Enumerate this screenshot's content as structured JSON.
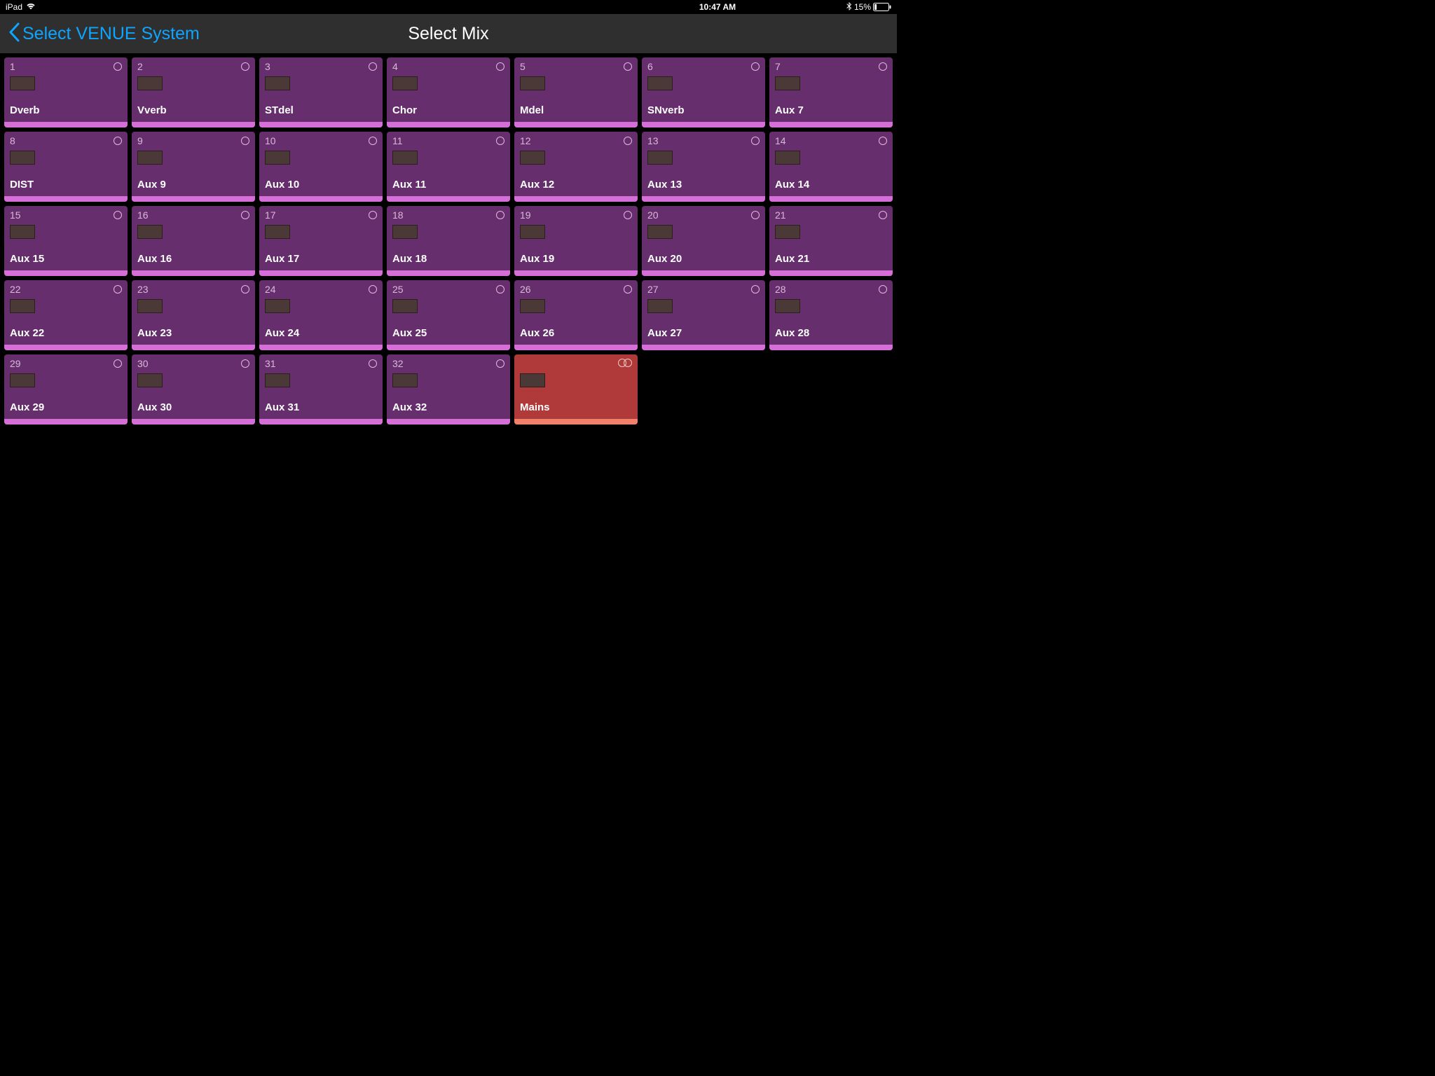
{
  "status_bar": {
    "device": "iPad",
    "time": "10:47 AM",
    "battery_pct": "15%"
  },
  "nav": {
    "back_label": "Select VENUE System",
    "title": "Select Mix"
  },
  "tiles": [
    {
      "num": "1",
      "label": "Dverb",
      "variant": "aux",
      "stereo": false
    },
    {
      "num": "2",
      "label": "Vverb",
      "variant": "aux",
      "stereo": false
    },
    {
      "num": "3",
      "label": "STdel",
      "variant": "aux",
      "stereo": false
    },
    {
      "num": "4",
      "label": "Chor",
      "variant": "aux",
      "stereo": false
    },
    {
      "num": "5",
      "label": "Mdel",
      "variant": "aux",
      "stereo": false
    },
    {
      "num": "6",
      "label": "SNverb",
      "variant": "aux",
      "stereo": false
    },
    {
      "num": "7",
      "label": "Aux 7",
      "variant": "aux",
      "stereo": false
    },
    {
      "num": "8",
      "label": "DIST",
      "variant": "aux",
      "stereo": false
    },
    {
      "num": "9",
      "label": "Aux 9",
      "variant": "aux",
      "stereo": false
    },
    {
      "num": "10",
      "label": "Aux 10",
      "variant": "aux",
      "stereo": false
    },
    {
      "num": "11",
      "label": "Aux 11",
      "variant": "aux",
      "stereo": false
    },
    {
      "num": "12",
      "label": "Aux 12",
      "variant": "aux",
      "stereo": false
    },
    {
      "num": "13",
      "label": "Aux 13",
      "variant": "aux",
      "stereo": false
    },
    {
      "num": "14",
      "label": "Aux 14",
      "variant": "aux",
      "stereo": false
    },
    {
      "num": "15",
      "label": "Aux 15",
      "variant": "aux",
      "stereo": false
    },
    {
      "num": "16",
      "label": "Aux 16",
      "variant": "aux",
      "stereo": false
    },
    {
      "num": "17",
      "label": "Aux 17",
      "variant": "aux",
      "stereo": false
    },
    {
      "num": "18",
      "label": "Aux 18",
      "variant": "aux",
      "stereo": false
    },
    {
      "num": "19",
      "label": "Aux 19",
      "variant": "aux",
      "stereo": false
    },
    {
      "num": "20",
      "label": "Aux 20",
      "variant": "aux",
      "stereo": false
    },
    {
      "num": "21",
      "label": "Aux 21",
      "variant": "aux",
      "stereo": false
    },
    {
      "num": "22",
      "label": "Aux 22",
      "variant": "aux",
      "stereo": false
    },
    {
      "num": "23",
      "label": "Aux 23",
      "variant": "aux",
      "stereo": false
    },
    {
      "num": "24",
      "label": "Aux 24",
      "variant": "aux",
      "stereo": false
    },
    {
      "num": "25",
      "label": "Aux 25",
      "variant": "aux",
      "stereo": false
    },
    {
      "num": "26",
      "label": "Aux 26",
      "variant": "aux",
      "stereo": false
    },
    {
      "num": "27",
      "label": "Aux 27",
      "variant": "aux",
      "stereo": false
    },
    {
      "num": "28",
      "label": "Aux 28",
      "variant": "aux",
      "stereo": false
    },
    {
      "num": "29",
      "label": "Aux 29",
      "variant": "aux",
      "stereo": false
    },
    {
      "num": "30",
      "label": "Aux 30",
      "variant": "aux",
      "stereo": false
    },
    {
      "num": "31",
      "label": "Aux 31",
      "variant": "aux",
      "stereo": false
    },
    {
      "num": "32",
      "label": "Aux 32",
      "variant": "aux",
      "stereo": false
    },
    {
      "num": "",
      "label": "Mains",
      "variant": "mains",
      "stereo": true
    }
  ]
}
